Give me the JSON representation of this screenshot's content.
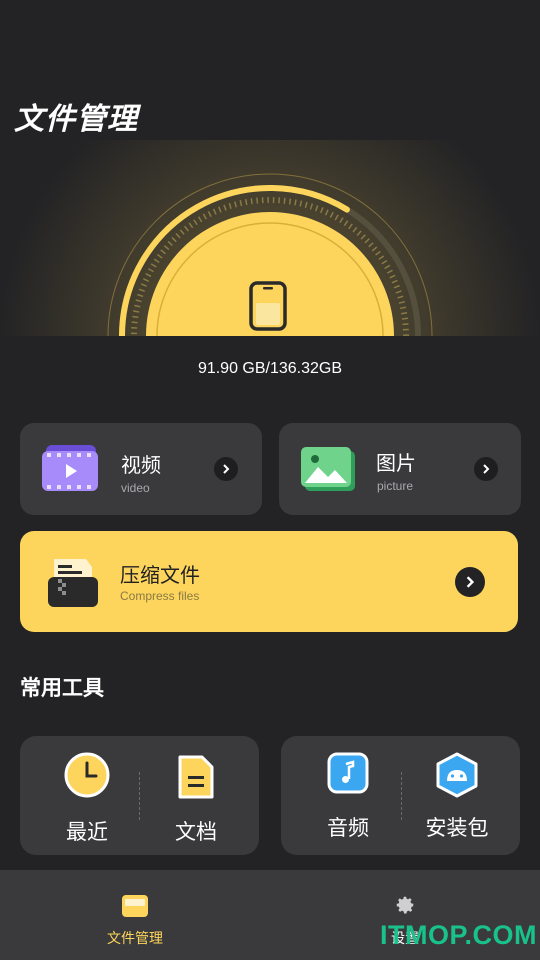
{
  "header": {
    "title": "文件管理"
  },
  "storage": {
    "text": "91.90 GB/136.32GB",
    "used_fraction": 0.674
  },
  "categories": {
    "video": {
      "title": "视频",
      "subtitle": "video"
    },
    "picture": {
      "title": "图片",
      "subtitle": "picture"
    },
    "compress": {
      "title": "压缩文件",
      "subtitle": "Compress files"
    }
  },
  "tools": {
    "section_title": "常用工具",
    "items": [
      {
        "label": "最近",
        "icon": "clock-icon"
      },
      {
        "label": "文档",
        "icon": "document-icon"
      },
      {
        "label": "音频",
        "icon": "music-icon"
      },
      {
        "label": "安装包",
        "icon": "android-icon"
      }
    ]
  },
  "nav": {
    "items": [
      {
        "label": "文件管理",
        "icon": "folder-icon",
        "active": true
      },
      {
        "label": "设置",
        "icon": "gear-icon",
        "active": false
      }
    ]
  },
  "watermark": "ITMOP.COM",
  "colors": {
    "background": "#232325",
    "card": "#3a3a3d",
    "accent": "#fdd55c",
    "nav_active": "#fdd55c"
  }
}
